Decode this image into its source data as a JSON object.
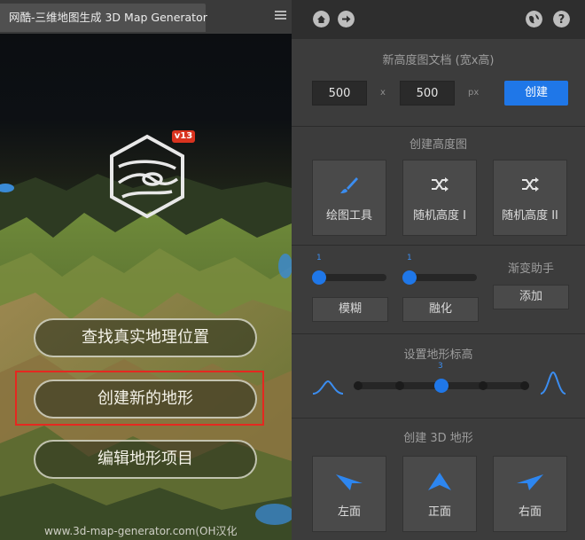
{
  "left": {
    "tab_title": "网酷-三维地图生成 3D Map Generator",
    "version_badge": "v13",
    "buttons": {
      "find_location": "查找真实地理位置",
      "create_terrain": "创建新的地形",
      "edit_project": "编辑地形项目"
    },
    "footer_url": "www.3d-map-generator.com(OH汉化"
  },
  "right": {
    "toolbar_icons": [
      "home-icon",
      "arrow-right-icon",
      "globe-icon",
      "help-icon"
    ],
    "new_doc": {
      "title": "新高度图文档 (宽x高)",
      "width": "500",
      "times": "x",
      "height": "500",
      "unit": "px",
      "create_label": "创建"
    },
    "create_heightmap": {
      "title": "创建高度图",
      "tools": [
        {
          "label": "绘图工具",
          "icon": "brush-icon"
        },
        {
          "label": "随机高度 I",
          "icon": "shuffle-icon"
        },
        {
          "label": "随机高度 II",
          "icon": "shuffle-icon"
        }
      ]
    },
    "sliders": {
      "blur_value": "1",
      "blur_label": "模糊",
      "melt_value": "1",
      "melt_label": "融化",
      "gradient_title": "渐变助手",
      "gradient_add": "添加"
    },
    "terrain_height": {
      "title": "设置地形标高",
      "value": "3",
      "value_fraction": 0.5
    },
    "create_3d": {
      "title": "创建 3D 地形",
      "views": [
        {
          "label": "左面",
          "icon": "arrow-left-view-icon"
        },
        {
          "label": "正面",
          "icon": "arrow-front-view-icon"
        },
        {
          "label": "右面",
          "icon": "arrow-right-view-icon"
        }
      ]
    }
  },
  "colors": {
    "accent_blue": "#1f77e8",
    "highlight_red": "#e52820",
    "badge_red": "#d9331f"
  }
}
